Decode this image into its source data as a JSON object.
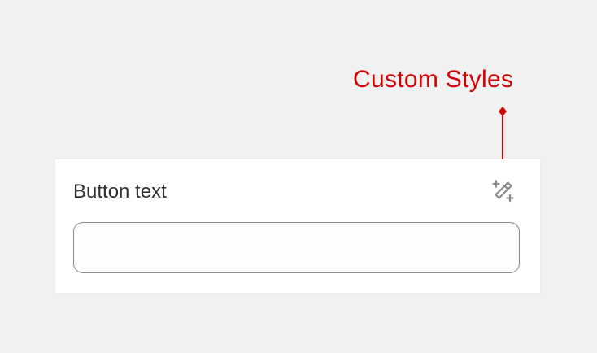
{
  "annotation": {
    "label": "Custom Styles",
    "color": "#d50000"
  },
  "field": {
    "label": "Button text",
    "value": "",
    "placeholder": ""
  },
  "icons": {
    "custom_styles_button": "magic-wand-sparkle-icon"
  },
  "colors": {
    "page_background": "#f1f1f1",
    "panel_background": "#ffffff",
    "label_text": "#303030",
    "icon": "#8a8a8a",
    "input_border": "#8a8a8a"
  }
}
